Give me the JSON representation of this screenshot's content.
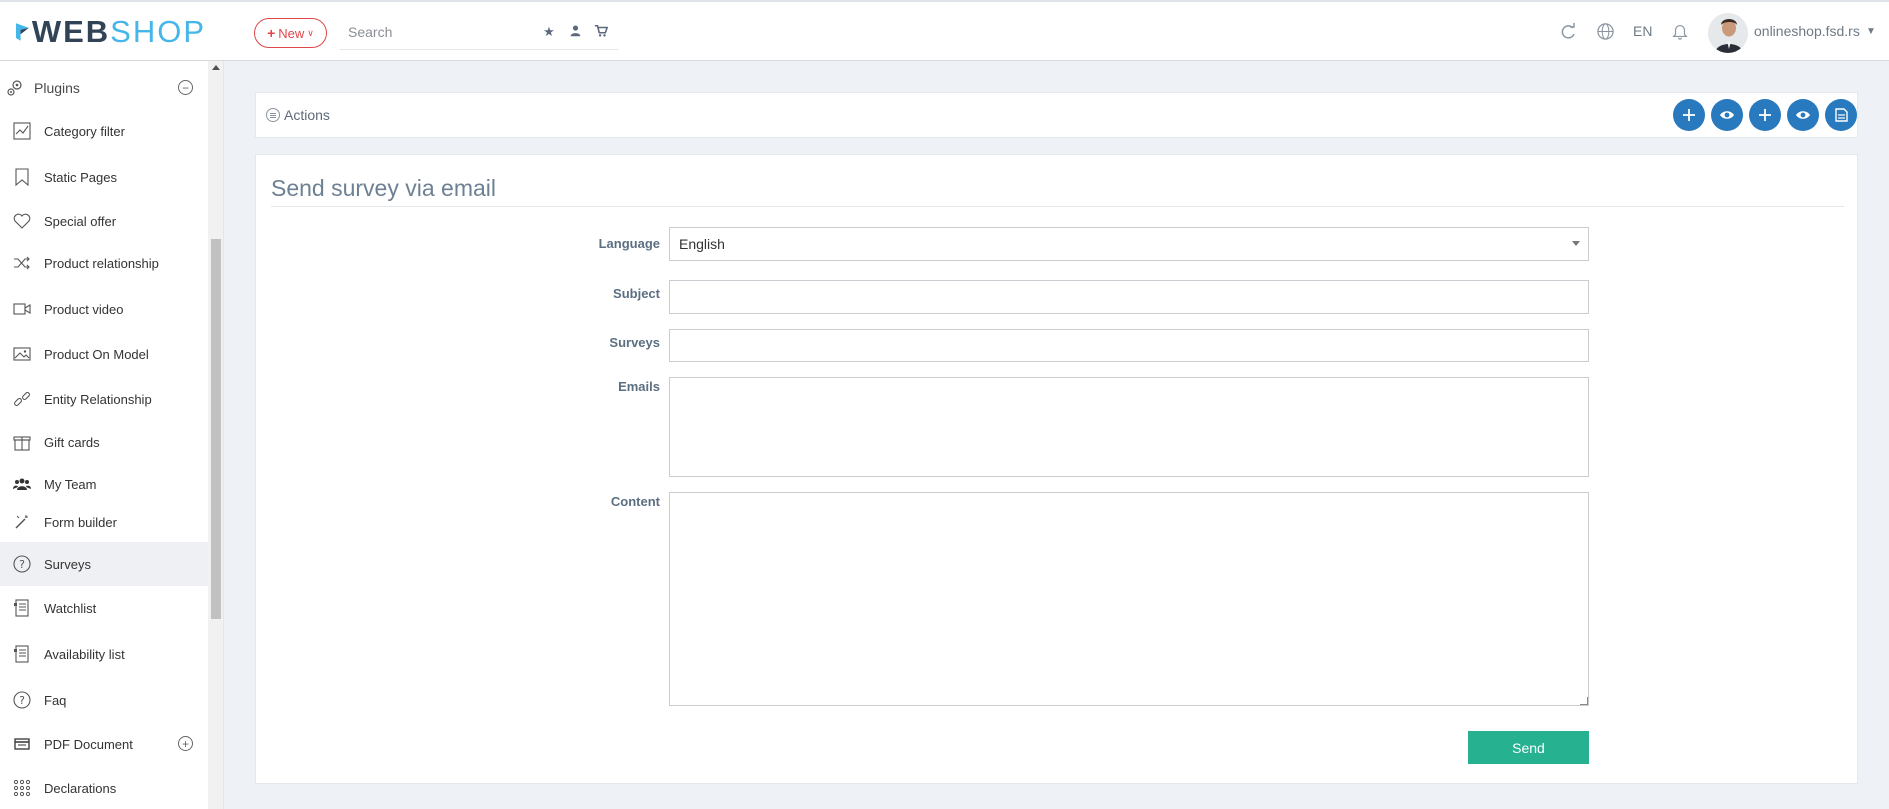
{
  "header": {
    "logo_web": "WEB",
    "logo_shop": "SHOP",
    "new_label": "New",
    "search_placeholder": "Search",
    "language": "EN",
    "shop_name": "onlineshop.fsd.rs"
  },
  "sidebar": {
    "section_label": "Plugins",
    "items": [
      {
        "label": "Category filter",
        "icon": "chart-icon"
      },
      {
        "label": "Static Pages",
        "icon": "bookmark-icon"
      },
      {
        "label": "Special offer",
        "icon": "heart-icon"
      },
      {
        "label": "Product relationship",
        "icon": "shuffle-icon"
      },
      {
        "label": "Product video",
        "icon": "video-icon"
      },
      {
        "label": "Product On Model",
        "icon": "image-icon"
      },
      {
        "label": "Entity Relationship",
        "icon": "link-icon"
      },
      {
        "label": "Gift cards",
        "icon": "gift-icon"
      },
      {
        "label": "My Team",
        "icon": "team-icon"
      },
      {
        "label": "Form builder",
        "icon": "magic-wand-icon"
      },
      {
        "label": "Surveys",
        "icon": "question-icon"
      },
      {
        "label": "Watchlist",
        "icon": "list-doc-icon"
      },
      {
        "label": "Availability list",
        "icon": "list-doc-icon"
      },
      {
        "label": "Faq",
        "icon": "question-icon"
      },
      {
        "label": "PDF Document",
        "icon": "card-icon"
      },
      {
        "label": "Declarations",
        "icon": "grid-dots-icon"
      }
    ],
    "active": "Surveys"
  },
  "actions": {
    "label": "Actions"
  },
  "form": {
    "title": "Send survey via email",
    "language_label": "Language",
    "language_value": "English",
    "subject_label": "Subject",
    "subject_value": "",
    "surveys_label": "Surveys",
    "surveys_value": "",
    "emails_label": "Emails",
    "emails_value": "",
    "content_label": "Content",
    "content_value": "",
    "send_label": "Send"
  },
  "colors": {
    "accent_blue": "#2879bd",
    "send_green": "#26b190",
    "new_red": "#e0474a",
    "logo_light": "#45b6e7",
    "logo_dark": "#314457"
  }
}
